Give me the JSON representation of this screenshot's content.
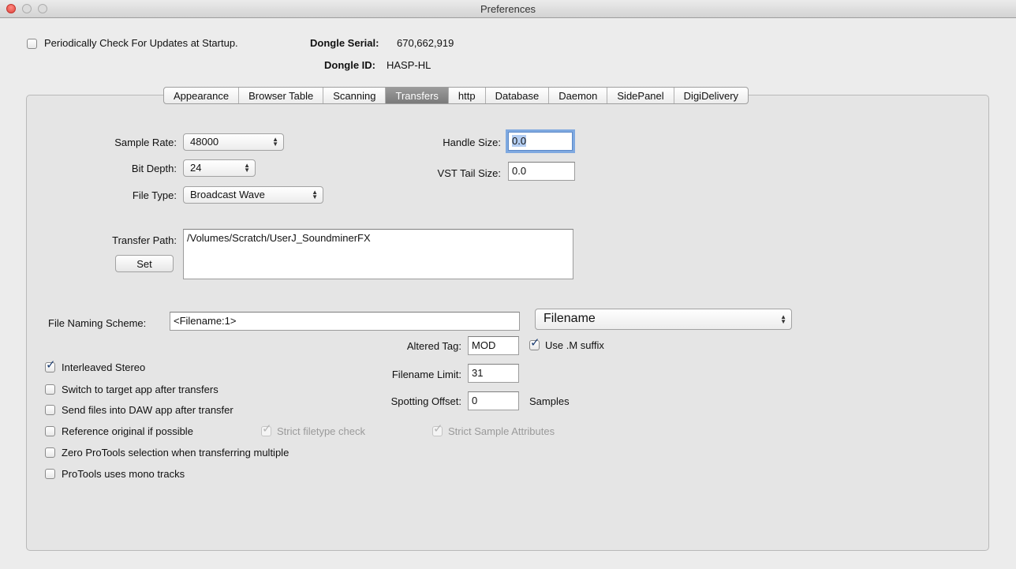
{
  "window": {
    "title": "Preferences"
  },
  "header": {
    "check_updates_label": "Periodically Check For Updates at Startup.",
    "check_updates_checked": false,
    "dongle_serial_label": "Dongle Serial:",
    "dongle_serial_value": "670,662,919",
    "dongle_id_label": "Dongle ID:",
    "dongle_id_value": "HASP-HL"
  },
  "tabs": [
    {
      "label": "Appearance",
      "active": false
    },
    {
      "label": "Browser Table",
      "active": false
    },
    {
      "label": "Scanning",
      "active": false
    },
    {
      "label": "Transfers",
      "active": true
    },
    {
      "label": "http",
      "active": false
    },
    {
      "label": "Database",
      "active": false
    },
    {
      "label": "Daemon",
      "active": false
    },
    {
      "label": "SidePanel",
      "active": false
    },
    {
      "label": "DigiDelivery",
      "active": false
    }
  ],
  "transfers": {
    "sample_rate_label": "Sample Rate:",
    "sample_rate_value": "48000",
    "bit_depth_label": "Bit Depth:",
    "bit_depth_value": "24",
    "file_type_label": "File Type:",
    "file_type_value": "Broadcast Wave",
    "handle_size_label": "Handle Size:",
    "handle_size_value": "0.0",
    "vst_tail_label": "VST Tail Size:",
    "vst_tail_value": "0.0",
    "transfer_path_label": "Transfer Path:",
    "transfer_path_value": "/Volumes/Scratch/UserJ_SoundminerFX",
    "set_button": "Set",
    "naming_scheme_label": "File Naming Scheme:",
    "naming_scheme_value": "<Filename:1>",
    "naming_token_value": "Filename",
    "altered_tag_label": "Altered Tag:",
    "altered_tag_value": "MOD",
    "use_m_suffix_label": "Use .M suffix",
    "filename_limit_label": "Filename Limit:",
    "filename_limit_value": "31",
    "spotting_offset_label": "Spotting Offset:",
    "spotting_offset_value": "0",
    "samples_label": "Samples",
    "interleaved_label": "Interleaved Stereo",
    "switch_target_label": "Switch to target app after transfers",
    "send_daw_label": "Send files into DAW app after transfer",
    "reference_original_label": "Reference original if possible",
    "strict_filetype_label": "Strict filetype check",
    "strict_sample_label": "Strict Sample Attributes",
    "zero_protools_label": "Zero ProTools selection when transferring multiple",
    "protools_mono_label": "ProTools uses mono tracks"
  }
}
